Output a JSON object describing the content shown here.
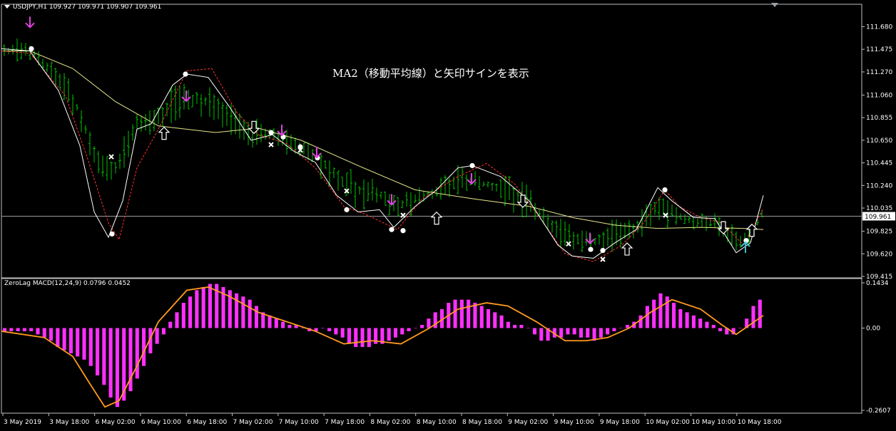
{
  "symbol_header": {
    "symbol": "USDJPY,H1",
    "open": "109.927",
    "high": "109.971",
    "low": "109.907",
    "close": "109.961"
  },
  "annotation": "MA2（移動平均線）と矢印サインを表示",
  "macd_header": {
    "name": "ZeroLag MACD(12,24,9)",
    "value1": "0.0796",
    "value2": "0.0452"
  },
  "price_axis": {
    "ticks": [
      "111.680",
      "111.475",
      "111.270",
      "111.060",
      "110.855",
      "110.650",
      "110.445",
      "110.240",
      "110.035",
      "109.825",
      "109.620",
      "109.415"
    ],
    "current_price": "109.961"
  },
  "macd_axis": {
    "ticks": [
      "0.1434",
      "0.00",
      "-0.2607"
    ]
  },
  "time_axis": {
    "labels": [
      "3 May 2019",
      "3 May 18:00",
      "6 May 02:00",
      "6 May 10:00",
      "6 May 18:00",
      "7 May 02:00",
      "7 May 10:00",
      "7 May 18:00",
      "8 May 02:00",
      "8 May 10:00",
      "8 May 18:00",
      "9 May 02:00",
      "9 May 10:00",
      "9 May 18:00",
      "10 May 02:00",
      "10 May 10:00",
      "10 May 18:00"
    ]
  },
  "colors": {
    "background": "#000000",
    "candles": "#00c000",
    "ma_slow": "#e6e68c",
    "band_upper_line": "#ffffff",
    "band_lower_dotted": "#ff3030",
    "sell_arrow": "#e040e0",
    "buy_arrow_outline": "#ffffff",
    "buy_arrow_cyan": "#40c0d0",
    "macd_histogram": "#ff30ff",
    "macd_signal": "#ff9a20",
    "axis": "#c0c0c0"
  },
  "chart_data": [
    {
      "type": "candlestick",
      "title": "USDJPY,H1",
      "ylim": [
        109.415,
        111.78
      ],
      "y_ticks": [
        111.68,
        111.475,
        111.27,
        111.06,
        110.855,
        110.65,
        110.445,
        110.24,
        110.035,
        109.825,
        109.62,
        109.415
      ],
      "close_line": 109.961,
      "ma_slow": [
        [
          0,
          111.46
        ],
        [
          40,
          111.46
        ],
        [
          100,
          111.3
        ],
        [
          160,
          111.0
        ],
        [
          220,
          110.78
        ],
        [
          300,
          110.72
        ],
        [
          360,
          110.76
        ],
        [
          420,
          110.65
        ],
        [
          500,
          110.42
        ],
        [
          580,
          110.2
        ],
        [
          660,
          110.12
        ],
        [
          740,
          110.05
        ],
        [
          800,
          109.95
        ],
        [
          860,
          109.88
        ],
        [
          920,
          109.85
        ],
        [
          980,
          109.86
        ],
        [
          1040,
          109.85
        ],
        [
          1068,
          109.84
        ]
      ],
      "band_white": [
        [
          0,
          111.48
        ],
        [
          40,
          111.46
        ],
        [
          80,
          111.1
        ],
        [
          110,
          110.6
        ],
        [
          130,
          110.0
        ],
        [
          150,
          109.77
        ],
        [
          170,
          110.1
        ],
        [
          190,
          110.75
        ],
        [
          210,
          110.8
        ],
        [
          240,
          111.15
        ],
        [
          260,
          111.25
        ],
        [
          290,
          111.22
        ],
        [
          320,
          110.95
        ],
        [
          350,
          110.65
        ],
        [
          380,
          110.7
        ],
        [
          410,
          110.55
        ],
        [
          440,
          110.45
        ],
        [
          470,
          110.15
        ],
        [
          500,
          110.0
        ],
        [
          530,
          110.02
        ],
        [
          550,
          109.86
        ],
        [
          580,
          110.05
        ],
        [
          610,
          110.2
        ],
        [
          640,
          110.4
        ],
        [
          660,
          110.42
        ],
        [
          700,
          110.32
        ],
        [
          740,
          110.1
        ],
        [
          780,
          109.7
        ],
        [
          800,
          109.6
        ],
        [
          830,
          109.58
        ],
        [
          860,
          109.72
        ],
        [
          890,
          109.84
        ],
        [
          920,
          110.22
        ],
        [
          940,
          110.1
        ],
        [
          970,
          109.95
        ],
        [
          1000,
          109.94
        ],
        [
          1030,
          109.63
        ],
        [
          1050,
          109.72
        ],
        [
          1068,
          110.15
        ]
      ],
      "band_red": [
        [
          0,
          111.46
        ],
        [
          40,
          111.44
        ],
        [
          90,
          111.05
        ],
        [
          120,
          110.5
        ],
        [
          150,
          109.9
        ],
        [
          165,
          109.75
        ],
        [
          190,
          110.4
        ],
        [
          220,
          110.75
        ],
        [
          260,
          111.28
        ],
        [
          295,
          111.3
        ],
        [
          330,
          110.9
        ],
        [
          360,
          110.7
        ],
        [
          400,
          110.62
        ],
        [
          440,
          110.4
        ],
        [
          480,
          110.05
        ],
        [
          510,
          109.98
        ],
        [
          555,
          109.84
        ],
        [
          590,
          110.12
        ],
        [
          640,
          110.32
        ],
        [
          680,
          110.44
        ],
        [
          720,
          110.25
        ],
        [
          760,
          109.9
        ],
        [
          790,
          109.62
        ],
        [
          830,
          109.55
        ],
        [
          870,
          109.7
        ],
        [
          900,
          109.9
        ],
        [
          930,
          110.2
        ],
        [
          950,
          110.05
        ],
        [
          980,
          109.95
        ],
        [
          1010,
          109.9
        ],
        [
          1040,
          109.7
        ],
        [
          1068,
          110.03
        ]
      ],
      "white_dots": [
        [
          42,
          111.48
        ],
        [
          155,
          109.8
        ],
        [
          258,
          111.25
        ],
        [
          378,
          110.72
        ],
        [
          395,
          110.68
        ],
        [
          419,
          110.59
        ],
        [
          443,
          110.49
        ],
        [
          484,
          110.02
        ],
        [
          547,
          109.84
        ],
        [
          563,
          109.83
        ],
        [
          660,
          110.42
        ],
        [
          826,
          109.66
        ],
        [
          843,
          109.65
        ],
        [
          930,
          110.2
        ],
        [
          1044,
          109.74
        ]
      ],
      "cross_marks": [
        [
          154,
          110.5
        ],
        [
          378,
          110.61
        ],
        [
          419,
          110.56
        ],
        [
          484,
          110.19
        ],
        [
          563,
          109.97
        ],
        [
          795,
          109.71
        ],
        [
          843,
          109.57
        ],
        [
          931,
          109.97
        ]
      ],
      "sell_arrows": [
        [
          40,
          111.72
        ],
        [
          259,
          111.05
        ],
        [
          393,
          110.74
        ],
        [
          442,
          110.54
        ],
        [
          547,
          110.11
        ],
        [
          659,
          110.3
        ],
        [
          825,
          109.76
        ]
      ],
      "buy_arrows_outline": [
        [
          228,
          110.71
        ],
        [
          354,
          110.77
        ],
        [
          610,
          109.94
        ],
        [
          731,
          110.1
        ],
        [
          877,
          109.66
        ],
        [
          1012,
          109.86
        ],
        [
          1052,
          109.83
        ]
      ],
      "buy_arrows_cyan": [
        [
          1043,
          109.68
        ]
      ]
    },
    {
      "type": "bar",
      "title": "ZeroLag MACD(12,24,9)",
      "ylim": [
        -0.2607,
        0.1434
      ],
      "y_ticks": [
        0.1434,
        0.0,
        -0.2607
      ],
      "series": [
        {
          "name": "histogram",
          "values": [
            -0.01,
            -0.01,
            -0.01,
            -0.01,
            -0.01,
            -0.02,
            -0.03,
            -0.04,
            -0.06,
            -0.07,
            -0.08,
            -0.09,
            -0.1,
            -0.12,
            -0.15,
            -0.18,
            -0.22,
            -0.25,
            -0.23,
            -0.2,
            -0.16,
            -0.12,
            -0.08,
            -0.05,
            -0.02,
            0.02,
            0.05,
            0.08,
            0.1,
            0.12,
            0.13,
            0.14,
            0.14,
            0.13,
            0.12,
            0.11,
            0.1,
            0.09,
            0.07,
            0.05,
            0.04,
            0.03,
            0.02,
            0.01,
            0.01,
            0.0,
            -0.01,
            -0.01,
            0.0,
            -0.01,
            -0.02,
            -0.03,
            -0.05,
            -0.06,
            -0.06,
            -0.06,
            -0.05,
            -0.05,
            -0.04,
            -0.03,
            -0.02,
            -0.01,
            0.0,
            0.01,
            0.03,
            0.05,
            0.06,
            0.08,
            0.09,
            0.09,
            0.09,
            0.08,
            0.07,
            0.06,
            0.05,
            0.04,
            0.02,
            0.01,
            0.01,
            0.0,
            -0.02,
            -0.04,
            -0.04,
            -0.03,
            -0.03,
            -0.02,
            -0.02,
            -0.03,
            -0.03,
            -0.04,
            -0.03,
            -0.02,
            -0.01,
            0.0,
            0.01,
            0.02,
            0.04,
            0.07,
            0.09,
            0.11,
            0.1,
            0.08,
            0.06,
            0.05,
            0.04,
            0.03,
            0.02,
            0.01,
            -0.01,
            -0.02,
            -0.02,
            0.0,
            0.03,
            0.07,
            0.09
          ]
        },
        {
          "name": "signal",
          "values": [
            [
              0,
              -0.01
            ],
            [
              60,
              -0.03
            ],
            [
              100,
              -0.09
            ],
            [
              125,
              -0.18
            ],
            [
              145,
              -0.25
            ],
            [
              165,
              -0.23
            ],
            [
              190,
              -0.12
            ],
            [
              220,
              0.02
            ],
            [
              260,
              0.12
            ],
            [
              290,
              0.13
            ],
            [
              320,
              0.1
            ],
            [
              360,
              0.05
            ],
            [
              400,
              0.02
            ],
            [
              440,
              -0.01
            ],
            [
              480,
              -0.05
            ],
            [
              520,
              -0.04
            ],
            [
              560,
              -0.05
            ],
            [
              600,
              0.0
            ],
            [
              640,
              0.06
            ],
            [
              680,
              0.08
            ],
            [
              710,
              0.07
            ],
            [
              750,
              0.02
            ],
            [
              790,
              -0.04
            ],
            [
              820,
              -0.04
            ],
            [
              850,
              -0.03
            ],
            [
              880,
              0.0
            ],
            [
              910,
              0.05
            ],
            [
              940,
              0.09
            ],
            [
              980,
              0.06
            ],
            [
              1010,
              0.01
            ],
            [
              1030,
              -0.02
            ],
            [
              1068,
              0.04
            ]
          ]
        }
      ]
    }
  ]
}
